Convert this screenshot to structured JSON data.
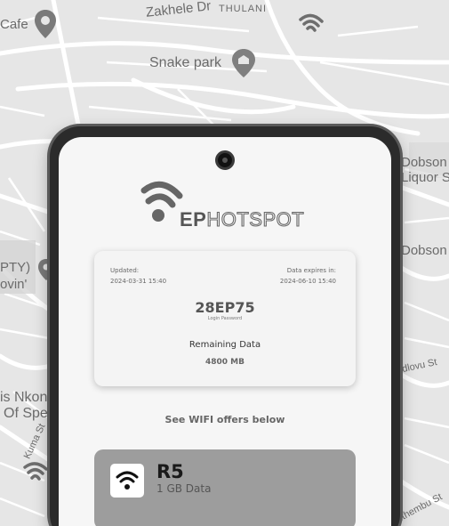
{
  "map": {
    "labels": {
      "cafe": "Cafe",
      "zakhele": "Zakhele Dr",
      "thulani": "THULANI",
      "snake_park": "Snake park",
      "dobson_liquor": "Dobson",
      "dobson_liquor_line2": "Liquor S",
      "dobson": "Dobson",
      "pty": "PTY)",
      "lovin": "ovin'",
      "nkon": "is Nkon",
      "of_spe": "Of Spe",
      "kuma_st": "Kuma St",
      "dlovu_st": "dlovu St",
      "ithembu_st": "ithembu St"
    }
  },
  "app": {
    "brand_bold": "EP",
    "brand_outline": "HOTSPOT",
    "info_card": {
      "updated_label": "Updated:",
      "updated_value": "2024-03-31 15:40",
      "expires_label": "Data expires in:",
      "expires_value": "2024-06-10 15:40",
      "login_code": "28EP75",
      "login_label": "Login Password",
      "remaining_label": "Remaining Data",
      "remaining_value": "4800 MB"
    },
    "offers_heading": "See WIFI offers below",
    "offers": [
      {
        "price": "R5",
        "data": "1 GB Data",
        "icon": "wifi-icon"
      }
    ]
  },
  "colors": {
    "phone_frame": "#2b2b2b",
    "screen_bg": "#f6f6f6",
    "offer_card_bg": "#9d9d9d",
    "map_bg": "#e4e4e4"
  }
}
